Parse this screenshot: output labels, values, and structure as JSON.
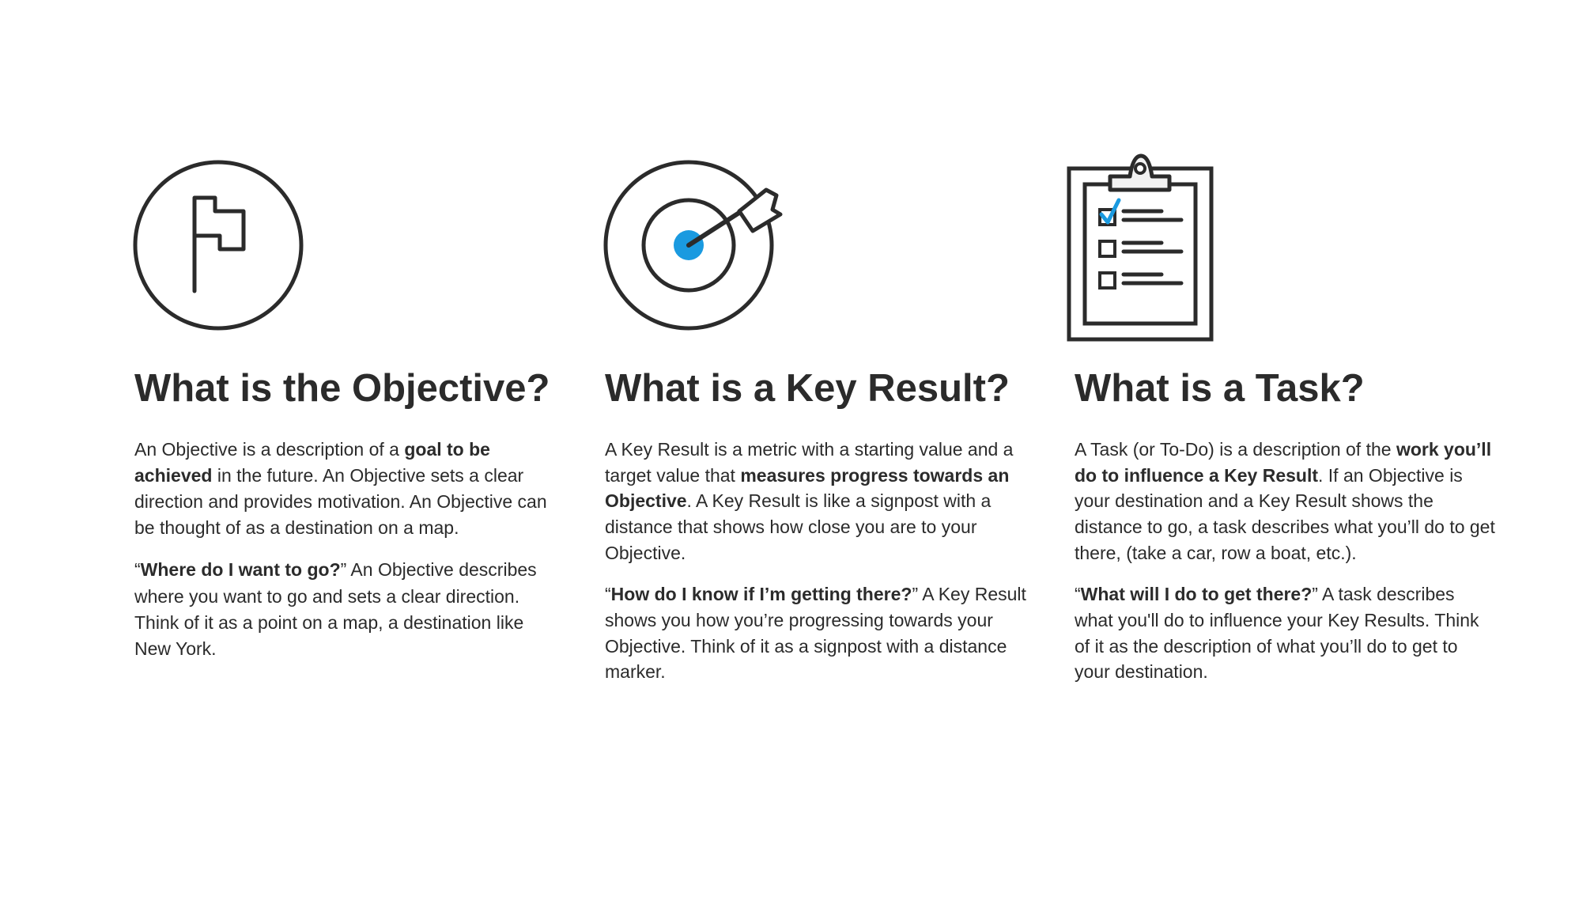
{
  "accent_color": "#1a9ae0",
  "stroke_color": "#2b2b2b",
  "columns": {
    "objective": {
      "icon": "flag-in-circle-icon",
      "heading": "What is the Objective?",
      "p1": {
        "a": "An Objective is a description of a ",
        "b": "goal to be achieved",
        "c": " in the future. An Objective sets a clear direction and provides motivation. An Objective can be thought of as a destination on a map."
      },
      "p2": {
        "a": "“",
        "b": "Where do I want to go?",
        "c": "” An Objective describes where you want to go and sets a clear direction. Think of it as a point on a map, a destination like New York."
      }
    },
    "keyresult": {
      "icon": "target-with-arrow-icon",
      "heading": "What is a Key Result?",
      "p1": {
        "a": "A Key Result is a metric with a starting value and a target value that ",
        "b": "measures progress towards an Objective",
        "c": ". A Key Result is like a signpost with a distance that shows how close you are to your Objective."
      },
      "p2": {
        "a": "“",
        "b": "How do I know if I’m getting there?",
        "c": "” A Key Result shows you how you’re progressing towards your Objective. Think of it as a signpost with a distance marker."
      }
    },
    "task": {
      "icon": "clipboard-checklist-icon",
      "heading": "What is a Task?",
      "p1": {
        "a": "A Task (or To-Do) is a description of the ",
        "b": "work you’ll do to influence a Key Result",
        "c": ". If an Objective is your destination and a Key Result shows the distance to go, a task describes what you’ll do to get there, (take a car, row a boat, etc.)."
      },
      "p2": {
        "a": "“",
        "b": "What will I do to get there?",
        "c": "” A task describes what you'll do to influence your Key Results. Think of it as the description of what you’ll do to get to your destination."
      }
    }
  }
}
